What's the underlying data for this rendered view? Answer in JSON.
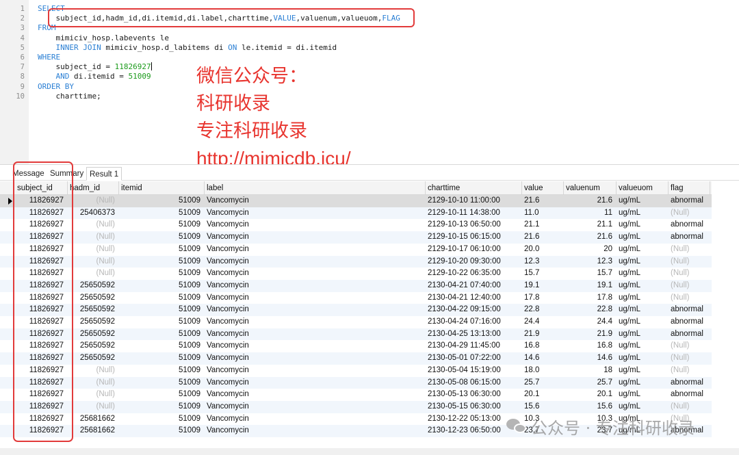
{
  "editor": {
    "line_numbers": [
      "1",
      "2",
      "3",
      "4",
      "5",
      "6",
      "7",
      "8",
      "9",
      "10"
    ],
    "lines": [
      [
        {
          "t": "SELECT",
          "c": "kw"
        }
      ],
      [
        {
          "t": "    subject_id,hadm_id,di.itemid,di.label,charttime,"
        },
        {
          "t": "VALUE",
          "c": "kw"
        },
        {
          "t": ",valuenum,valueuom,"
        },
        {
          "t": "FLAG",
          "c": "kw"
        }
      ],
      [
        {
          "t": "FROM",
          "c": "kw"
        }
      ],
      [
        {
          "t": "    mimiciv_hosp.labevents le"
        }
      ],
      [
        {
          "t": "    "
        },
        {
          "t": "INNER JOIN",
          "c": "kw"
        },
        {
          "t": " mimiciv_hosp.d_labitems di "
        },
        {
          "t": "ON",
          "c": "kw"
        },
        {
          "t": " le.itemid = di.itemid"
        }
      ],
      [
        {
          "t": "WHERE",
          "c": "kw"
        }
      ],
      [
        {
          "t": "    subject_id = "
        },
        {
          "t": "11826927",
          "c": "num"
        },
        {
          "t": "",
          "c": "cursor"
        }
      ],
      [
        {
          "t": "    "
        },
        {
          "t": "AND",
          "c": "kw"
        },
        {
          "t": " di.itemid = "
        },
        {
          "t": "51009",
          "c": "num"
        }
      ],
      [
        {
          "t": "ORDER BY",
          "c": "kw"
        }
      ],
      [
        {
          "t": "    charttime;"
        }
      ]
    ]
  },
  "watermark_red": {
    "line1": "微信公众号：",
    "line2": "科研收录",
    "line3": "专注科研收录",
    "url": "http://mimicdb.icu/"
  },
  "tabs": [
    {
      "label": "Message",
      "active": false
    },
    {
      "label": "Summary",
      "active": false
    },
    {
      "label": "Result 1",
      "active": true
    }
  ],
  "grid": {
    "columns": [
      "subject_id",
      "hadm_id",
      "itemid",
      "label",
      "charttime",
      "value",
      "valuenum",
      "valueuom",
      "flag"
    ],
    "null_text": "(Null)",
    "rows": [
      [
        "11826927",
        null,
        "51009",
        "Vancomycin",
        "2129-10-10 11:00:00",
        "21.6",
        "21.6",
        "ug/mL",
        "abnormal"
      ],
      [
        "11826927",
        "25406373",
        "51009",
        "Vancomycin",
        "2129-10-11 14:38:00",
        "11.0",
        "11",
        "ug/mL",
        null
      ],
      [
        "11826927",
        null,
        "51009",
        "Vancomycin",
        "2129-10-13 06:50:00",
        "21.1",
        "21.1",
        "ug/mL",
        "abnormal"
      ],
      [
        "11826927",
        null,
        "51009",
        "Vancomycin",
        "2129-10-15 06:15:00",
        "21.6",
        "21.6",
        "ug/mL",
        "abnormal"
      ],
      [
        "11826927",
        null,
        "51009",
        "Vancomycin",
        "2129-10-17 06:10:00",
        "20.0",
        "20",
        "ug/mL",
        null
      ],
      [
        "11826927",
        null,
        "51009",
        "Vancomycin",
        "2129-10-20 09:30:00",
        "12.3",
        "12.3",
        "ug/mL",
        null
      ],
      [
        "11826927",
        null,
        "51009",
        "Vancomycin",
        "2129-10-22 06:35:00",
        "15.7",
        "15.7",
        "ug/mL",
        null
      ],
      [
        "11826927",
        "25650592",
        "51009",
        "Vancomycin",
        "2130-04-21 07:40:00",
        "19.1",
        "19.1",
        "ug/mL",
        null
      ],
      [
        "11826927",
        "25650592",
        "51009",
        "Vancomycin",
        "2130-04-21 12:40:00",
        "17.8",
        "17.8",
        "ug/mL",
        null
      ],
      [
        "11826927",
        "25650592",
        "51009",
        "Vancomycin",
        "2130-04-22 09:15:00",
        "22.8",
        "22.8",
        "ug/mL",
        "abnormal"
      ],
      [
        "11826927",
        "25650592",
        "51009",
        "Vancomycin",
        "2130-04-24 07:16:00",
        "24.4",
        "24.4",
        "ug/mL",
        "abnormal"
      ],
      [
        "11826927",
        "25650592",
        "51009",
        "Vancomycin",
        "2130-04-25 13:13:00",
        "21.9",
        "21.9",
        "ug/mL",
        "abnormal"
      ],
      [
        "11826927",
        "25650592",
        "51009",
        "Vancomycin",
        "2130-04-29 11:45:00",
        "16.8",
        "16.8",
        "ug/mL",
        null
      ],
      [
        "11826927",
        "25650592",
        "51009",
        "Vancomycin",
        "2130-05-01 07:22:00",
        "14.6",
        "14.6",
        "ug/mL",
        null
      ],
      [
        "11826927",
        null,
        "51009",
        "Vancomycin",
        "2130-05-04 15:19:00",
        "18.0",
        "18",
        "ug/mL",
        null
      ],
      [
        "11826927",
        null,
        "51009",
        "Vancomycin",
        "2130-05-08 06:15:00",
        "25.7",
        "25.7",
        "ug/mL",
        "abnormal"
      ],
      [
        "11826927",
        null,
        "51009",
        "Vancomycin",
        "2130-05-13 06:30:00",
        "20.1",
        "20.1",
        "ug/mL",
        "abnormal"
      ],
      [
        "11826927",
        null,
        "51009",
        "Vancomycin",
        "2130-05-15 06:30:00",
        "15.6",
        "15.6",
        "ug/mL",
        null
      ],
      [
        "11826927",
        "25681662",
        "51009",
        "Vancomycin",
        "2130-12-22 05:13:00",
        "10.3",
        "10.3",
        "ug/mL",
        null
      ],
      [
        "11826927",
        "25681662",
        "51009",
        "Vancomycin",
        "2130-12-23 06:50:00",
        "23.7",
        "23.7",
        "ug/mL",
        "abnormal"
      ]
    ]
  },
  "watermark_grey": {
    "text": "公众号 · 专注科研收录",
    "icon": "wechat-icon"
  },
  "colors": {
    "keyword": "#2a7fd4",
    "number": "#1a9a1a",
    "highlight_box": "#e23a3a",
    "watermark_red": "#e8352f",
    "null": "#b7b7b7"
  }
}
